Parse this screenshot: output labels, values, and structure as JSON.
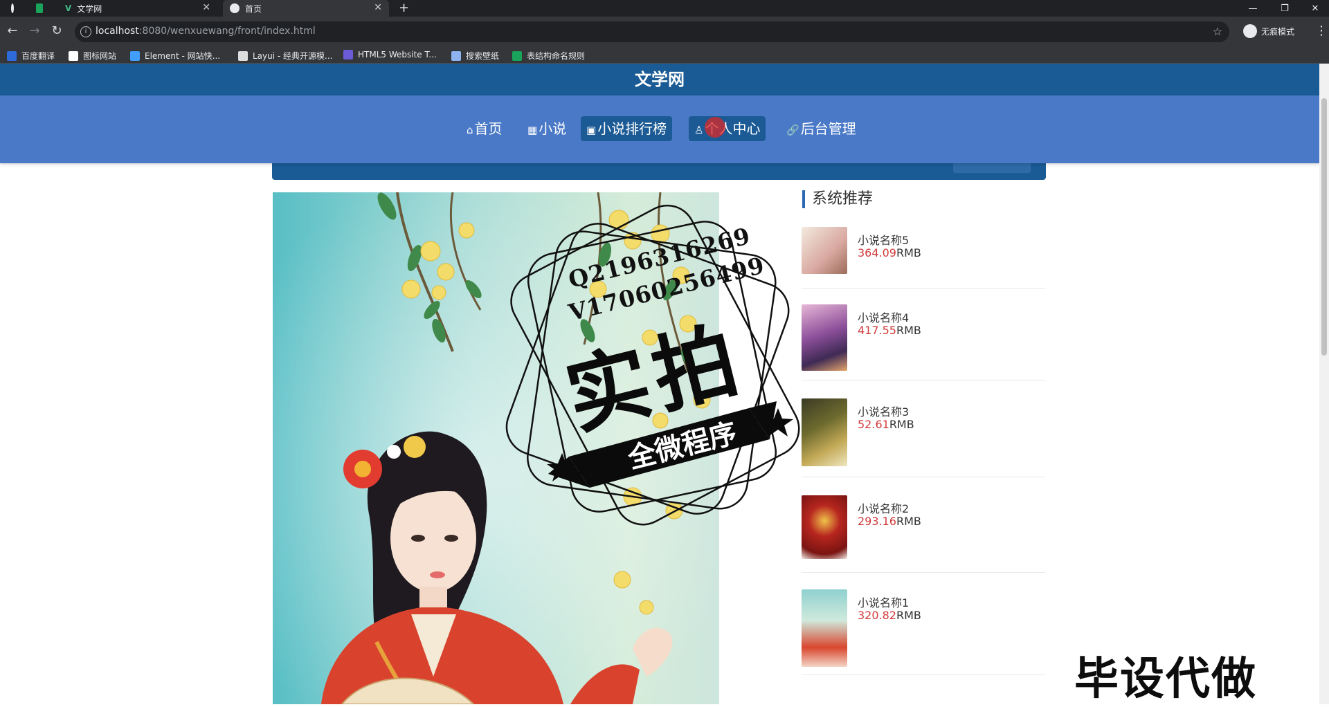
{
  "browser": {
    "tabs": [
      {
        "title": "",
        "active": false
      },
      {
        "title": "",
        "active": false
      },
      {
        "title": "文学网",
        "active": false
      },
      {
        "title": "首页",
        "active": true
      }
    ],
    "url_host": "localhost",
    "url_path": ":8080/wenxuewang/front/index.html",
    "incognito_label": "无痕模式",
    "bookmarks": [
      {
        "label": "百度翻译",
        "color": "#2f6bd8"
      },
      {
        "label": "图标网站",
        "color": "#ffffff"
      },
      {
        "label": "Element - 网站快...",
        "color": "#409eff"
      },
      {
        "label": "Layui - 经典开源模...",
        "color": "#dddddd"
      },
      {
        "label": "HTML5 Website T...",
        "color": "#6b5bd6"
      },
      {
        "label": "搜索壁纸",
        "color": "#8fb3f0"
      },
      {
        "label": "表结构命名规则",
        "color": "#1aa35b"
      }
    ]
  },
  "site": {
    "title": "文学网",
    "nav": [
      {
        "icon": "⌂",
        "label": "首页",
        "boxed": false
      },
      {
        "icon": "▦",
        "label": "小说",
        "boxed": false
      },
      {
        "icon": "▣",
        "label": "小说排行榜",
        "boxed": true
      },
      {
        "icon": "♙",
        "label": "个人中心",
        "boxed": true
      },
      {
        "icon": "🔗",
        "label": "后台管理",
        "boxed": false
      }
    ]
  },
  "recommend": {
    "title": "系统推荐",
    "items": [
      {
        "name": "小说名称5",
        "price": "364.09",
        "unit": "RMB"
      },
      {
        "name": "小说名称4",
        "price": "417.55",
        "unit": "RMB"
      },
      {
        "name": "小说名称3",
        "price": "52.61",
        "unit": "RMB"
      },
      {
        "name": "小说名称2",
        "price": "293.16",
        "unit": "RMB"
      },
      {
        "name": "小说名称1",
        "price": "320.82",
        "unit": "RMB"
      }
    ]
  },
  "watermark": {
    "line1": "Q2196316269",
    "line2": "V17060256499",
    "big": "实拍",
    "ribbon": "全微程序",
    "corner": "毕设代做"
  }
}
